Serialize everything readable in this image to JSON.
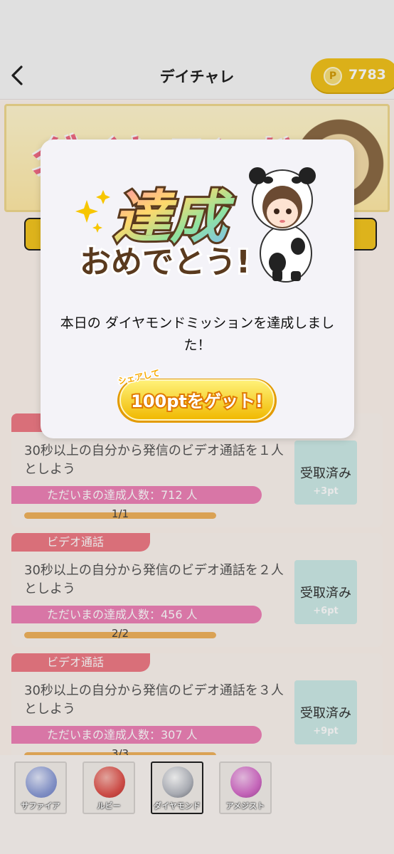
{
  "header": {
    "title": "デイチャレ",
    "points": "7783",
    "points_coin": "P"
  },
  "banner": {
    "title": "ダイヤモンド"
  },
  "missions": [
    {
      "category": "ビデオ通話",
      "text": "30秒以上の自分から発信のビデオ通話を１人としよう",
      "achievers": "ただいまの達成人数：712 人",
      "progress": "1/1",
      "progress_fraction": 1,
      "status": "受取済み",
      "reward": "+3pt"
    },
    {
      "category": "ビデオ通話",
      "text": "30秒以上の自分から発信のビデオ通話を２人としよう",
      "achievers": "ただいまの達成人数：456 人",
      "progress": "2/2",
      "progress_fraction": 1,
      "status": "受取済み",
      "reward": "+6pt"
    },
    {
      "category": "ビデオ通話",
      "text": "30秒以上の自分から発信のビデオ通話を３人としよう",
      "achievers": "ただいまの達成人数：307 人",
      "progress": "3/3",
      "progress_fraction": 1,
      "status": "受取済み",
      "reward": "+9pt"
    }
  ],
  "gem_tabs": [
    {
      "label": "サファイア",
      "color": "#8f9fd8",
      "selected": false
    },
    {
      "label": "ルビー",
      "color": "#e0554f",
      "selected": false
    },
    {
      "label": "ダイヤモンド",
      "color": "#b9bcc4",
      "selected": true
    },
    {
      "label": "アメジスト",
      "color": "#d76fcb",
      "selected": false
    }
  ],
  "modal": {
    "congrats_line1": "達成",
    "congrats_line2": "おめでとう!",
    "message": "本日の ダイヤモンドミッションを達成しました！",
    "share_small": "シェアして",
    "share_main": "100ptをゲット!"
  },
  "colors": {
    "accent_yellow": "#f1c21c",
    "category_red": "#ef7a85",
    "achievers_pink": "#ee82b7",
    "progress_orange": "#f0b25d",
    "claimed_teal": "#cdebe7"
  }
}
